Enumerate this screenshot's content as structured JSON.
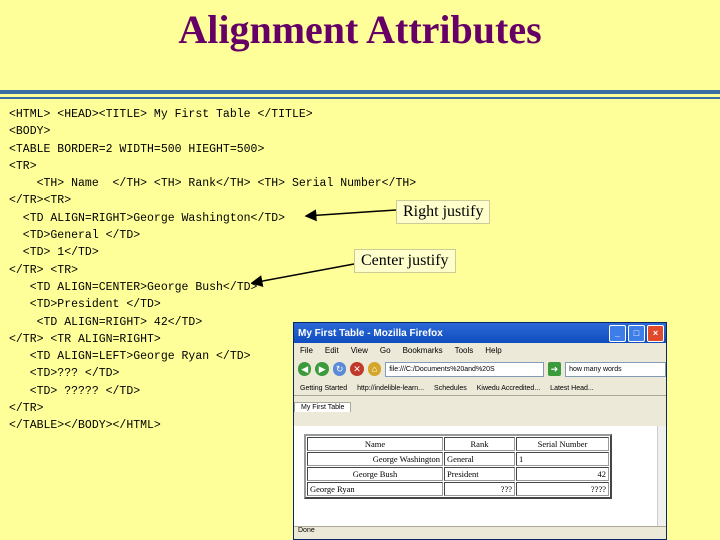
{
  "slide": {
    "title": "Alignment Attributes",
    "code_lines": [
      "<HTML> <HEAD><TITLE> My First Table </TITLE>",
      "<BODY>",
      "<TABLE BORDER=2 WIDTH=500 HIEGHT=500>",
      "<TR>",
      "    <TH> Name  </TH> <TH> Rank</TH> <TH> Serial Number</TH>",
      "</TR><TR>",
      "  <TD ALIGN=RIGHT>George Washington</TD>",
      "  <TD>General </TD>",
      "  <TD> 1</TD>",
      "</TR> <TR>",
      "   <TD ALIGN=CENTER>George Bush</TD>",
      "   <TD>President </TD>",
      "    <TD ALIGN=RIGHT> 42</TD>",
      "</TR> <TR ALIGN=RIGHT>",
      "   <TD ALIGN=LEFT>George Ryan </TD>",
      "   <TD>??? </TD>",
      "   <TD> ????? </TD>",
      "</TR>",
      "</TABLE></BODY></HTML>"
    ],
    "callouts": {
      "right": "Right justify",
      "center": "Center justify"
    }
  },
  "browser": {
    "window_title": "My First Table - Mozilla Firefox",
    "menu": [
      "File",
      "Edit",
      "View",
      "Go",
      "Bookmarks",
      "Tools",
      "Help"
    ],
    "url": "file:///C:/Documents%20and%20S",
    "search_text": "how many words",
    "bookmarks": [
      "Getting Started",
      "http://indelible-learn...",
      "Schedules",
      "Kiwedu Accredited...",
      "Latest Head..."
    ],
    "tab_label": "My First Table",
    "table": {
      "headers": [
        "Name",
        "Rank",
        "Serial Number"
      ],
      "rows": [
        [
          "George Washington",
          "General",
          "1"
        ],
        [
          "George Bush",
          "President",
          "42"
        ],
        [
          "George Ryan",
          "???",
          "????"
        ]
      ]
    },
    "status": "Done"
  }
}
